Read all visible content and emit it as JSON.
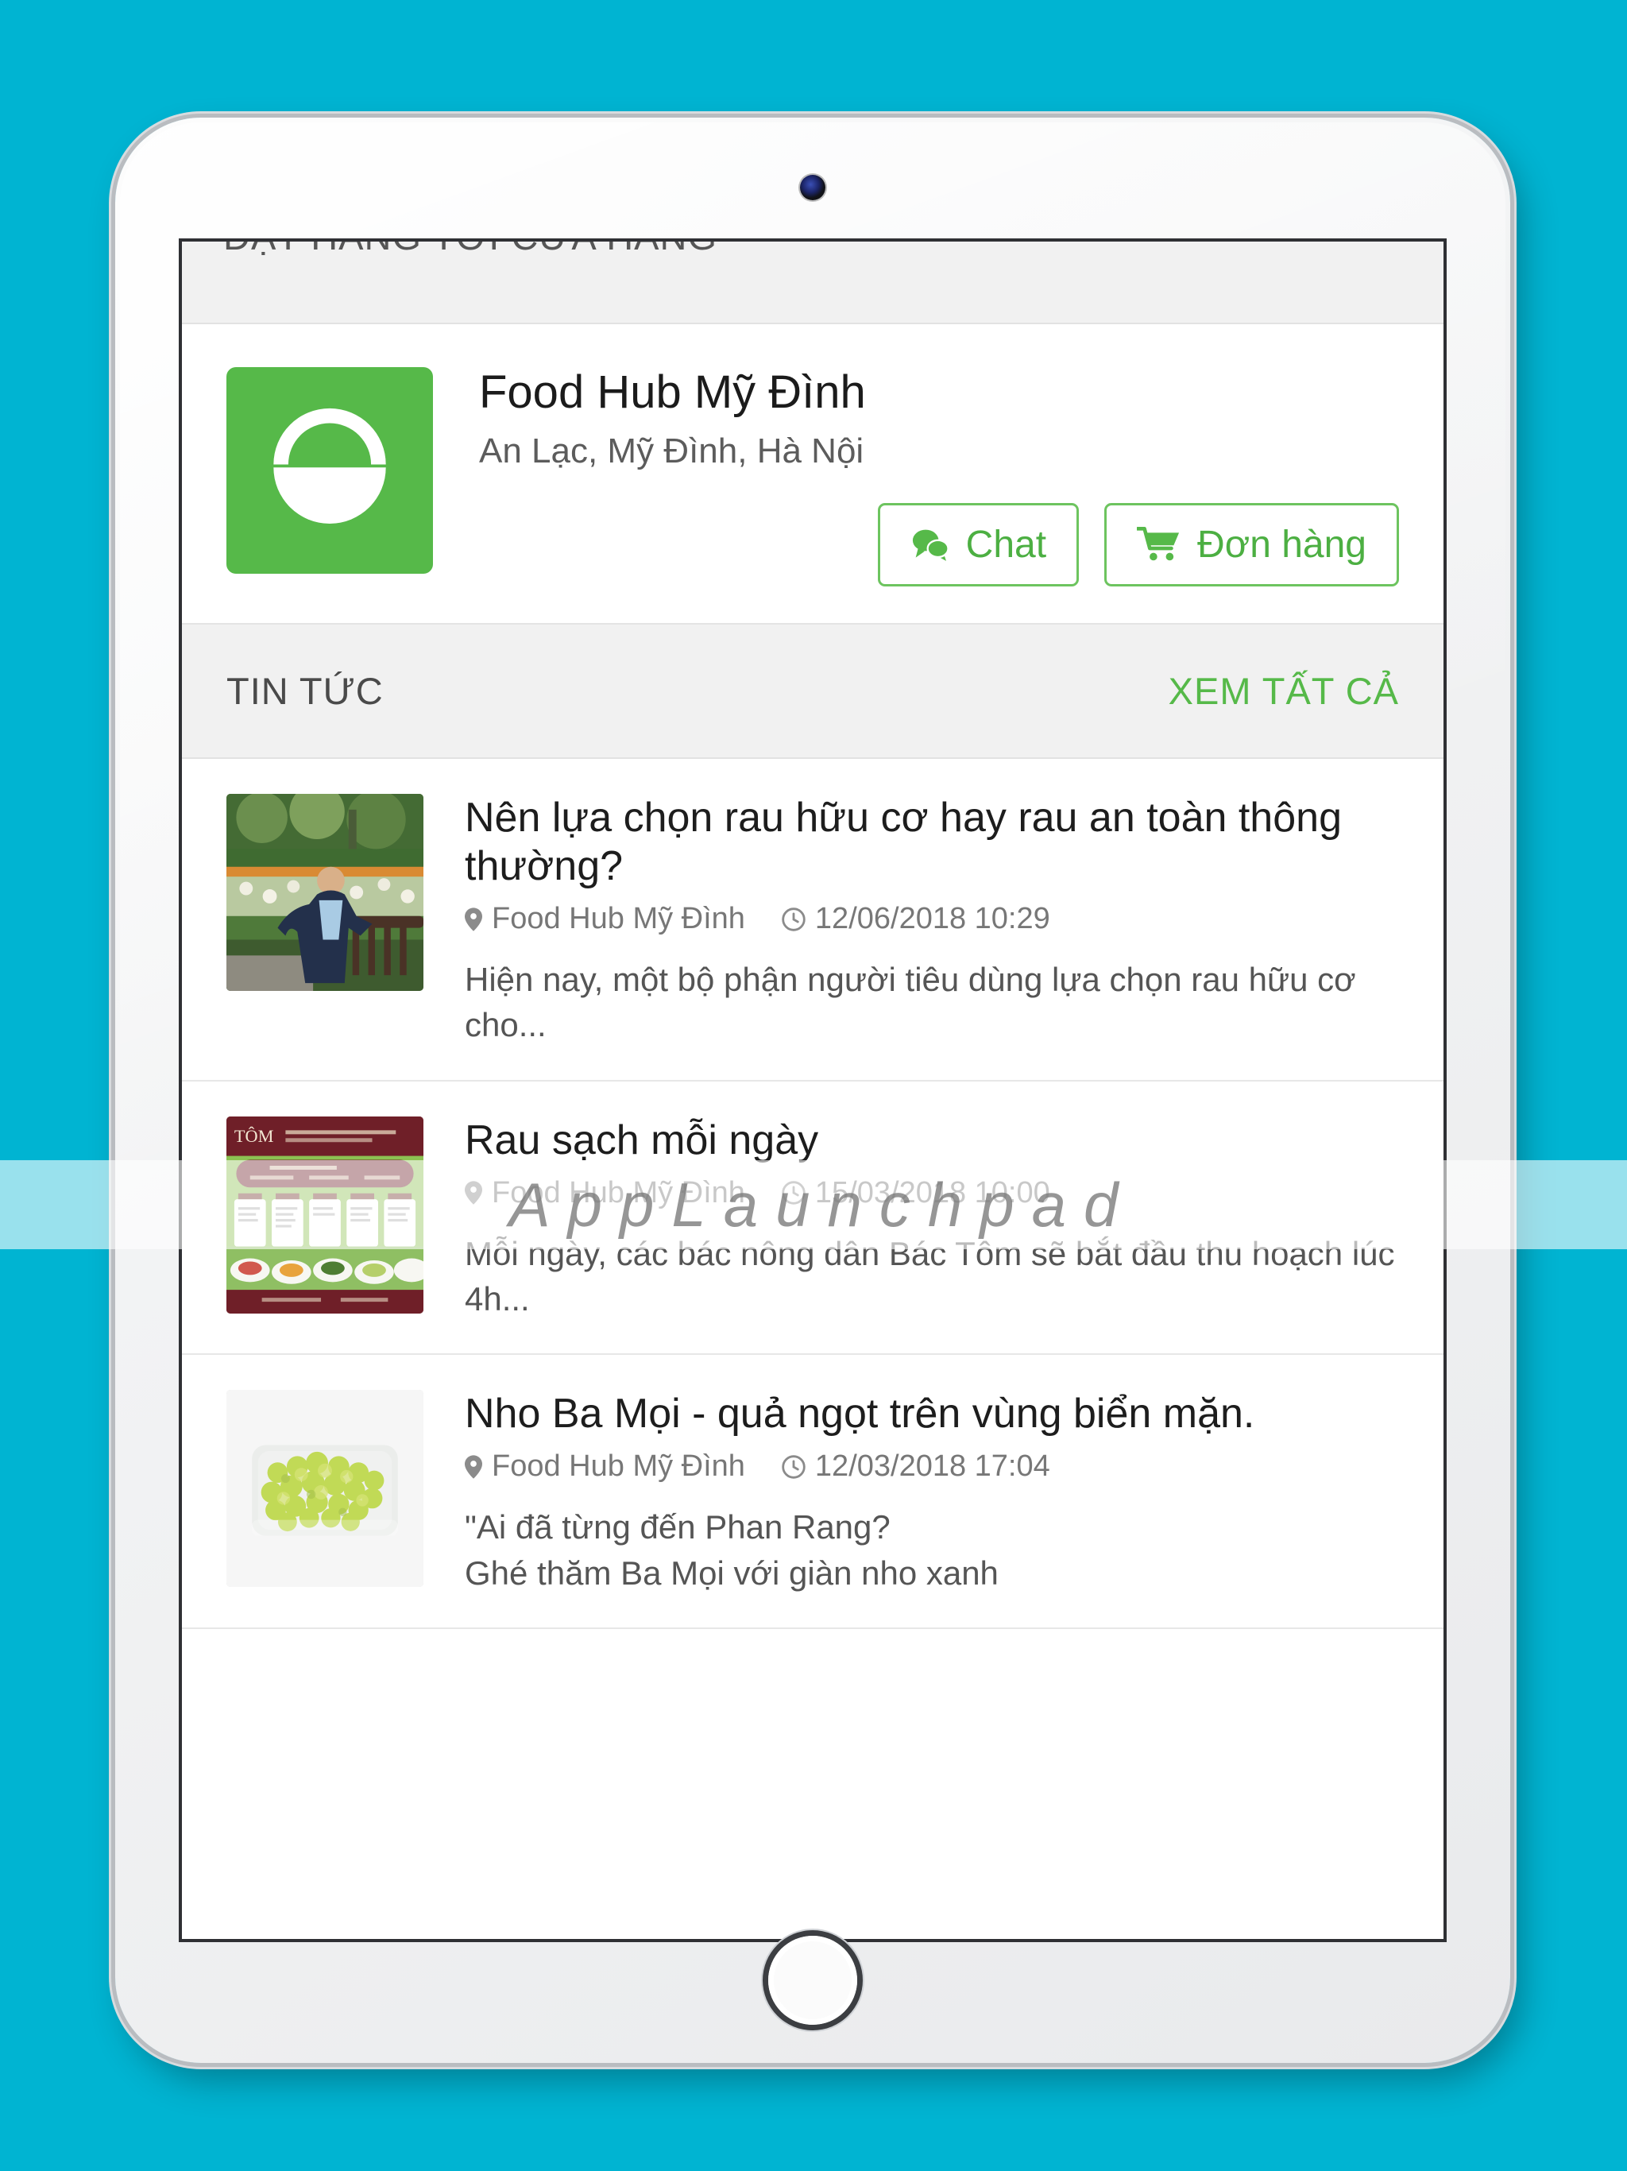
{
  "background": {
    "color": "#00b4d2"
  },
  "device": {
    "type": "tablet",
    "camera_icon": "camera-icon",
    "home_button_label": "Home"
  },
  "screen": {
    "clipped_heading": "ĐẶT HÀNG TỚI CỬA HÀNG",
    "store": {
      "logo_icon": "shopping-basket-icon",
      "logo_color": "#56b949",
      "name": "Food Hub Mỹ Đình",
      "address": "An Lạc, Mỹ Đình, Hà Nội",
      "actions": [
        {
          "label": "Chat",
          "icon": "comments-icon"
        },
        {
          "label": "Đơn hàng",
          "icon": "shopping-cart-icon"
        }
      ]
    },
    "news_section": {
      "title": "TIN TỨC",
      "action_label": "XEM TẤT CẢ",
      "accent_color": "#56b949",
      "items": [
        {
          "title": "Nên lựa chọn rau hữu cơ hay rau an toàn thông thường?",
          "source": "Food Hub Mỹ Đình",
          "source_icon": "map-marker-icon",
          "time": "12/06/2018 10:29",
          "time_icon": "clock-icon",
          "excerpt": "Hiện nay, một bộ phận người tiêu dùng lựa chọn rau hữu cơ cho...",
          "thumbnail": "man-on-bench-in-flower-garden"
        },
        {
          "title": "Rau sạch mỗi ngày",
          "source": "Food Hub Mỹ Đình",
          "source_icon": "map-marker-icon",
          "time": "15/03/2018 10:00",
          "time_icon": "clock-icon",
          "excerpt": "Mỗi ngày, các bác nông dân Bác Tôm sẽ bắt đầu thu hoạch lúc 4h...",
          "thumbnail": "bac-tom-schedule-poster"
        },
        {
          "title": "Nho Ba Mọi - quả ngọt trên vùng biển mặn.",
          "source": "Food Hub Mỹ Đình",
          "source_icon": "map-marker-icon",
          "time": "12/03/2018 17:04",
          "time_icon": "clock-icon",
          "excerpt": "\"Ai đã từng đến Phan Rang?\nGhé thăm Ba Mọi với giàn nho xanh",
          "thumbnail": "green-grapes-tray"
        }
      ]
    }
  },
  "watermark": {
    "text": "AppLaunchpad"
  }
}
